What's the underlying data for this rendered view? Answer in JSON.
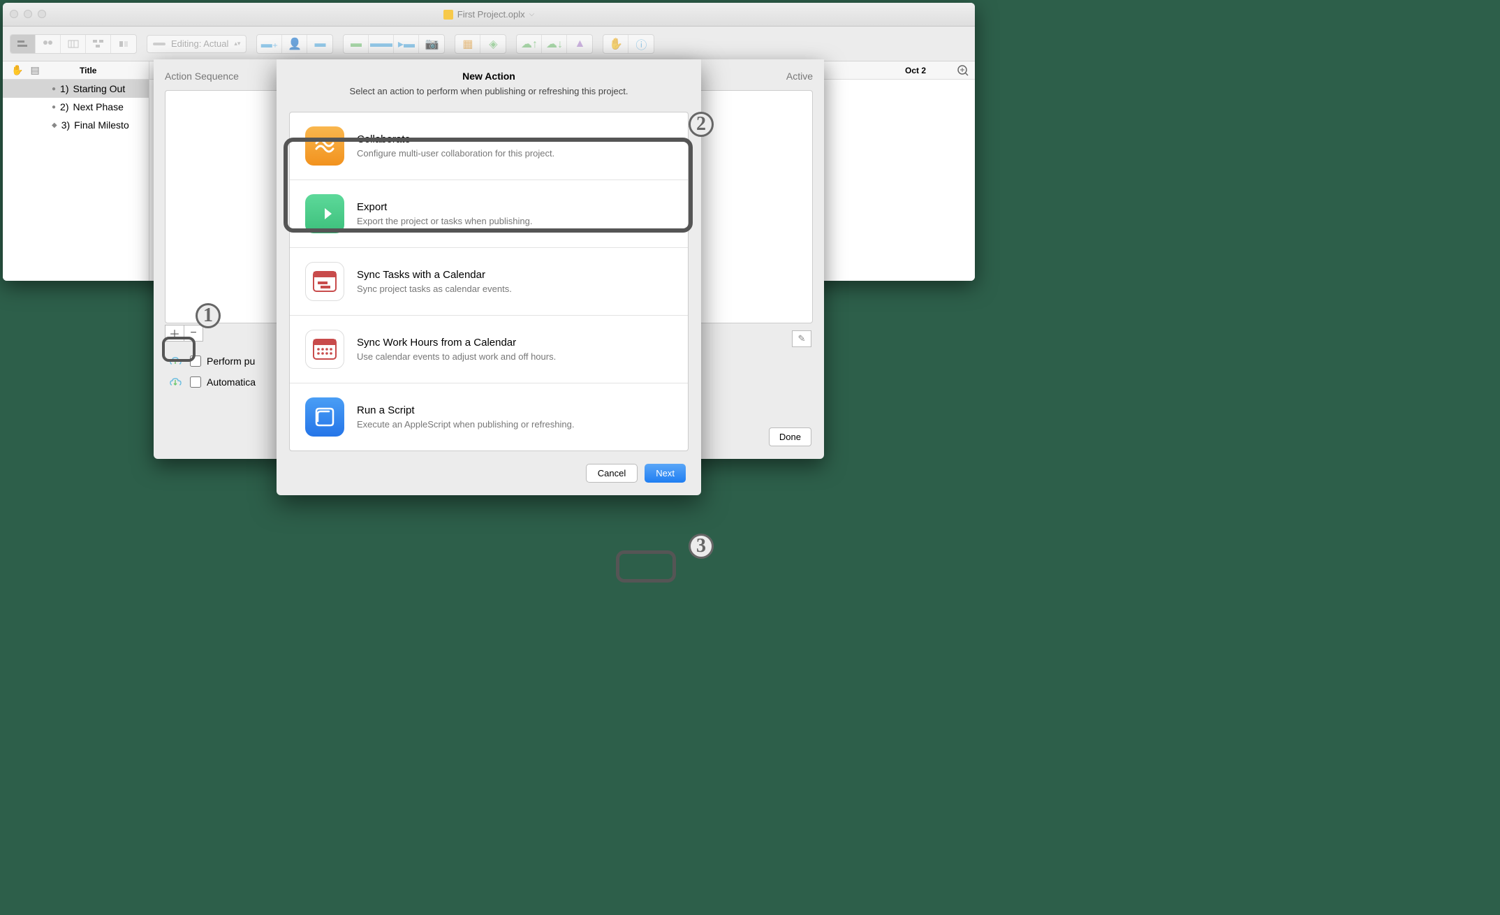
{
  "window": {
    "title": "First Project.oplx"
  },
  "toolbar": {
    "editing_label": "Editing: Actual"
  },
  "outline": {
    "header": "Title",
    "rows": [
      {
        "num": "1)",
        "label": "Starting Out"
      },
      {
        "num": "2)",
        "label": "Next Phase"
      },
      {
        "num": "3)",
        "label": "Final Milesto"
      }
    ]
  },
  "gantt": {
    "date": "Oct 2",
    "status": "Active"
  },
  "sheet": {
    "title": "Action Sequence",
    "check1": "Perform pu",
    "check2": "Automatica",
    "done": "Done"
  },
  "modal": {
    "title": "New Action",
    "subtitle": "Select an action to perform when publishing or refreshing this project.",
    "actions": [
      {
        "name": "Collaborate",
        "desc": "Configure multi-user collaboration for this project."
      },
      {
        "name": "Export",
        "desc": "Export the project or tasks when publishing."
      },
      {
        "name": "Sync Tasks with a Calendar",
        "desc": "Sync project tasks as calendar events."
      },
      {
        "name": "Sync Work Hours from a Calendar",
        "desc": "Use calendar events to adjust work and off hours."
      },
      {
        "name": "Run a Script",
        "desc": "Execute an AppleScript when publishing or refreshing."
      }
    ],
    "cancel": "Cancel",
    "next": "Next"
  },
  "callouts": {
    "n1": "1",
    "n2": "2",
    "n3": "3"
  }
}
